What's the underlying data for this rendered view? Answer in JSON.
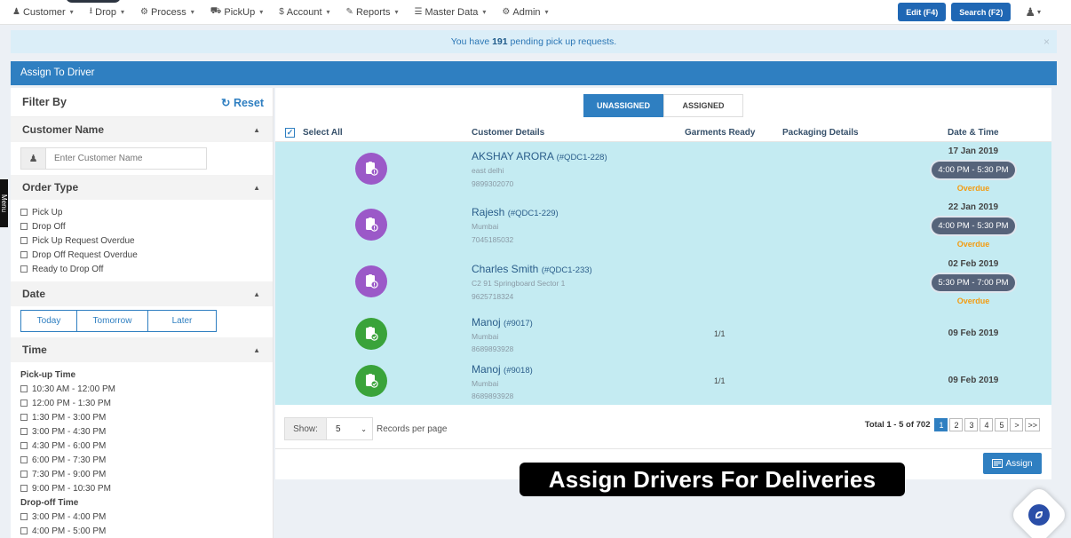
{
  "nav": {
    "items": [
      {
        "icon": "user-icon",
        "glyph": "♟",
        "label": "Customer"
      },
      {
        "icon": "download-icon",
        "glyph": "⭳",
        "label": "Drop"
      },
      {
        "icon": "process-icon",
        "glyph": "⚙",
        "label": "Process"
      },
      {
        "icon": "truck-icon",
        "glyph": "⛟",
        "label": "PickUp"
      },
      {
        "icon": "dollar-icon",
        "glyph": "$",
        "label": "Account"
      },
      {
        "icon": "reports-icon",
        "glyph": "✎",
        "label": "Reports"
      },
      {
        "icon": "list-icon",
        "glyph": "☰",
        "label": "Master Data"
      },
      {
        "icon": "gear-icon",
        "glyph": "⚙",
        "label": "Admin"
      }
    ],
    "edit_label": "Edit (F4)",
    "search_label": "Search (F2)"
  },
  "alert": {
    "prefix": "You have ",
    "count": "191",
    "suffix": " pending pick up requests."
  },
  "panel": {
    "title": "Assign To Driver"
  },
  "side_tab": {
    "label": "Menu"
  },
  "filter": {
    "title": "Filter By",
    "reset_label": "Reset",
    "customer_name": {
      "title": "Customer Name",
      "placeholder": "Enter Customer Name"
    },
    "order_type": {
      "title": "Order Type",
      "options": [
        "Pick Up",
        "Drop Off",
        "Pick Up Request Overdue",
        "Drop Off Request Overdue",
        "Ready to Drop Off"
      ]
    },
    "date": {
      "title": "Date",
      "buttons": [
        "Today",
        "Tomorrow",
        "Later"
      ]
    },
    "time": {
      "title": "Time",
      "pickup_label": "Pick-up Time",
      "pickup_slots": [
        "10:30 AM - 12:00 PM",
        "12:00 PM - 1:30 PM",
        "1:30 PM - 3:00 PM",
        "3:00 PM - 4:30 PM",
        "4:30 PM - 6:00 PM",
        "6:00 PM - 7:30 PM",
        "7:30 PM - 9:00 PM",
        "9:00 PM - 10:30 PM"
      ],
      "dropoff_label": "Drop-off Time",
      "dropoff_slots": [
        "3:00 PM - 4:00 PM",
        "4:00 PM - 5:00 PM"
      ]
    }
  },
  "tabs": {
    "unassigned": "UNASSIGNED",
    "assigned": "ASSIGNED",
    "active": "unassigned"
  },
  "table": {
    "headers": {
      "select_all": "Select All",
      "customer_details": "Customer Details",
      "garments_ready": "Garments Ready",
      "packaging_details": "Packaging Details",
      "date_time": "Date & Time"
    },
    "rows": [
      {
        "status": "purple",
        "name": "AKSHAY ARORA",
        "code": "(#QDC1-228)",
        "address": "east delhi",
        "phone": "9899302070",
        "garments": "",
        "date": "17 Jan 2019",
        "time": "4:00 PM - 5:30 PM",
        "state": "Overdue"
      },
      {
        "status": "purple",
        "name": "Rajesh",
        "code": "(#QDC1-229)",
        "address": "Mumbai",
        "phone": "7045185032",
        "garments": "",
        "date": "22 Jan 2019",
        "time": "4:00 PM - 5:30 PM",
        "state": "Overdue"
      },
      {
        "status": "purple",
        "name": "Charles Smith",
        "code": "(#QDC1-233)",
        "address": "C2 91 Springboard Sector 1",
        "phone": "9625718324",
        "garments": "",
        "date": "02 Feb 2019",
        "time": "5:30 PM - 7:00 PM",
        "state": "Overdue"
      },
      {
        "status": "green",
        "name": "Manoj",
        "code": "(#9017)",
        "address": "Mumbai",
        "phone": "8689893928",
        "garments": "1/1",
        "date": "09 Feb 2019",
        "time": "",
        "state": ""
      },
      {
        "status": "green",
        "name": "Manoj",
        "code": "(#9018)",
        "address": "Mumbai",
        "phone": "8689893928",
        "garments": "1/1",
        "date": "09 Feb 2019",
        "time": "",
        "state": ""
      }
    ]
  },
  "pagination": {
    "show_label": "Show:",
    "page_size": "5",
    "records_label": "Records per page",
    "total_label": "Total 1 - 5 of 702",
    "pages": [
      "1",
      "2",
      "3",
      "4",
      "5",
      ">",
      ">>"
    ],
    "active_page": "1"
  },
  "assign_label": "Assign",
  "caption": "Assign Drivers For Deliveries",
  "colors": {
    "primary": "#2f7fc1",
    "row_bg": "#c4ebf2",
    "overdue": "#f39c12",
    "pending_icon": "#9b59c8",
    "ready_icon": "#3aa33a"
  }
}
